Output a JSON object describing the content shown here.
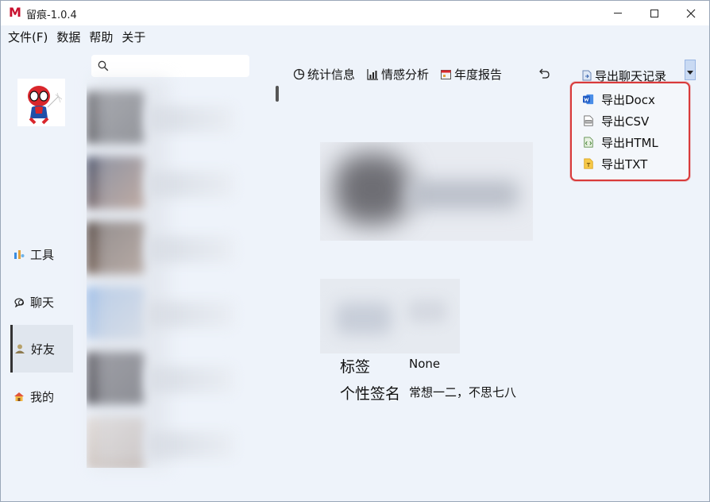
{
  "window": {
    "title": "留痕-1.0.4",
    "logo_letter": "M",
    "accent": "#c8102e"
  },
  "menu": {
    "items": [
      "文件(F)",
      "数据",
      "帮助",
      "关于"
    ]
  },
  "nav": {
    "items": [
      {
        "label": "工具",
        "icon": "tools-icon"
      },
      {
        "label": "聊天",
        "icon": "chat-icon"
      },
      {
        "label": "好友",
        "icon": "friend-icon",
        "active": true
      },
      {
        "label": "我的",
        "icon": "home-icon"
      }
    ]
  },
  "search": {
    "placeholder": ""
  },
  "toolbar": {
    "stats": "统计信息",
    "sentiment": "情感分析",
    "annual": "年度报告",
    "export": "导出聊天记录"
  },
  "export_menu": {
    "items": [
      {
        "label": "导出Docx",
        "icon": "word-icon"
      },
      {
        "label": "导出CSV",
        "icon": "csv-icon"
      },
      {
        "label": "导出HTML",
        "icon": "html-icon"
      },
      {
        "label": "导出TXT",
        "icon": "txt-icon"
      }
    ],
    "highlight_color": "#d93a3a"
  },
  "profile": {
    "tag_label": "标签",
    "tag_value": "None",
    "signature_label": "个性签名",
    "signature_value": "常想一二，不思七八"
  }
}
